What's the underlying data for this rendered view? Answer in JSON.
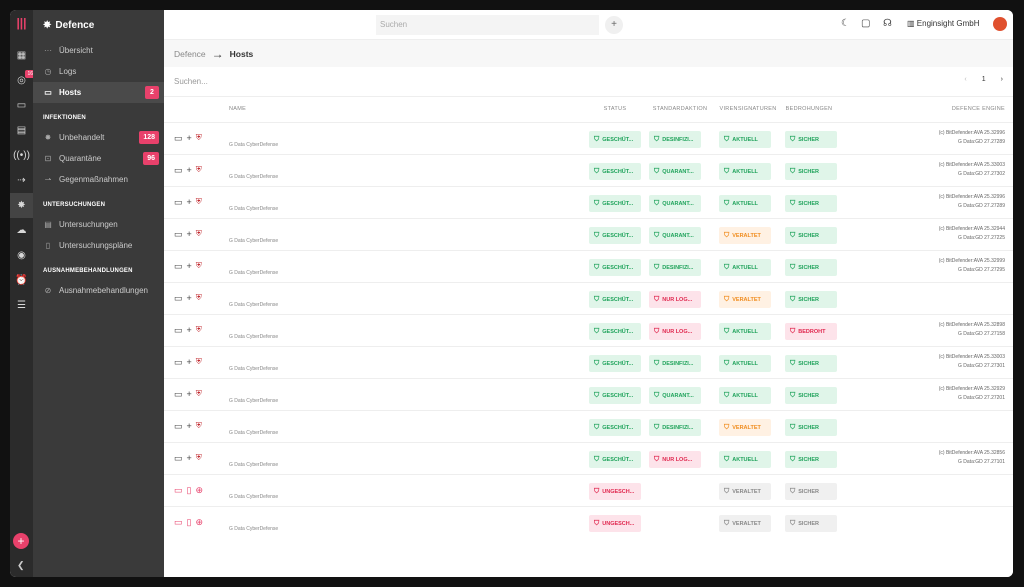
{
  "app": {
    "title": "Defence"
  },
  "rail": {
    "badge": "16"
  },
  "sidebar": {
    "items": [
      {
        "label": "Übersicht",
        "icon": "dots-icon"
      },
      {
        "label": "Logs",
        "icon": "clock-icon"
      },
      {
        "label": "Hosts",
        "icon": "laptop-icon",
        "count": "2"
      }
    ],
    "infektionen_title": "INFEKTIONEN",
    "infektionen": [
      {
        "label": "Unbehandelt",
        "icon": "virus-icon",
        "count": "128"
      },
      {
        "label": "Quarantäne",
        "icon": "quarantine-icon",
        "count": "96"
      },
      {
        "label": "Gegenmaßnahmen",
        "icon": "countermeasure-icon"
      }
    ],
    "untersuchungen_title": "UNTERSUCHUNGEN",
    "untersuchungen": [
      {
        "label": "Untersuchungen",
        "icon": "scan-icon"
      },
      {
        "label": "Untersuchungspläne",
        "icon": "schedule-icon"
      }
    ],
    "ausnahmen_title": "AUSNAHMEBEHANDLUNGEN",
    "ausnahmen": [
      {
        "label": "Ausnahmebehandlungen",
        "icon": "exception-icon"
      }
    ]
  },
  "topbar": {
    "search_placeholder": "Suchen",
    "org": "Enginsight GmbH"
  },
  "breadcrumb": {
    "parent": "Defence",
    "current": "Hosts"
  },
  "filter": {
    "placeholder": "Suchen...",
    "page": "1"
  },
  "table": {
    "headers": {
      "name": "NAME",
      "status": "STATUS",
      "action": "STANDARDAKTION",
      "sig": "VIRENSIGNATUREN",
      "threat": "BEDROHUNGEN",
      "engine": "DEFENCE ENGINE"
    },
    "rows": [
      {
        "name": "G Data CyberDefense",
        "status": "GESCHÜT...",
        "st": "ok",
        "action": "DESINFIZI...",
        "ac": "ok",
        "sig": "AKTUELL",
        "sg": "ok",
        "threat": "SICHER",
        "th": "ok",
        "e1": "(c) BitDefender:AVA 25.32996",
        "e2": "G Data:GD 27.27289",
        "bad": false
      },
      {
        "name": "G Data CyberDefense",
        "status": "GESCHÜT...",
        "st": "ok",
        "action": "QUARANT...",
        "ac": "ok",
        "sig": "AKTUELL",
        "sg": "ok",
        "threat": "SICHER",
        "th": "ok",
        "e1": "(c) BitDefender:AVA 25.33003",
        "e2": "G Data:GD 27.27302",
        "bad": false
      },
      {
        "name": "G Data CyberDefense",
        "status": "GESCHÜT...",
        "st": "ok",
        "action": "QUARANT...",
        "ac": "ok",
        "sig": "AKTUELL",
        "sg": "ok",
        "threat": "SICHER",
        "th": "ok",
        "e1": "(c) BitDefender:AVA 25.32996",
        "e2": "G Data:GD 27.27289",
        "bad": false
      },
      {
        "name": "G Data CyberDefense",
        "status": "GESCHÜT...",
        "st": "ok",
        "action": "QUARANT...",
        "ac": "ok",
        "sig": "VERALTET",
        "sg": "warn",
        "threat": "SICHER",
        "th": "ok",
        "e1": "(c) BitDefender:AVA 25.32944",
        "e2": "G Data:GD 27.27225",
        "bad": false
      },
      {
        "name": "G Data CyberDefense",
        "status": "GESCHÜT...",
        "st": "ok",
        "action": "DESINFIZI...",
        "ac": "ok",
        "sig": "AKTUELL",
        "sg": "ok",
        "threat": "SICHER",
        "th": "ok",
        "e1": "(c) BitDefender:AVA 25.32999",
        "e2": "G Data:GD 27.27295",
        "bad": false
      },
      {
        "name": "G Data CyberDefense",
        "status": "GESCHÜT...",
        "st": "ok",
        "action": "NUR LOG...",
        "ac": "err",
        "sig": "VERALTET",
        "sg": "warn",
        "threat": "SICHER",
        "th": "ok",
        "e1": "",
        "e2": "",
        "bad": false
      },
      {
        "name": "G Data CyberDefense",
        "status": "GESCHÜT...",
        "st": "ok",
        "action": "NUR LOG...",
        "ac": "err",
        "sig": "AKTUELL",
        "sg": "ok",
        "threat": "BEDROHT",
        "th": "err",
        "e1": "(c) BitDefender:AVA 25.32898",
        "e2": "G Data:GD 27.27158",
        "bad": false
      },
      {
        "name": "G Data CyberDefense",
        "status": "GESCHÜT...",
        "st": "ok",
        "action": "DESINFIZI...",
        "ac": "ok",
        "sig": "AKTUELL",
        "sg": "ok",
        "threat": "SICHER",
        "th": "ok",
        "e1": "(c) BitDefender:AVA 25.33003",
        "e2": "G Data:GD 27.27301",
        "bad": false
      },
      {
        "name": "G Data CyberDefense",
        "status": "GESCHÜT...",
        "st": "ok",
        "action": "QUARANT...",
        "ac": "ok",
        "sig": "AKTUELL",
        "sg": "ok",
        "threat": "SICHER",
        "th": "ok",
        "e1": "(c) BitDefender:AVA 25.32929",
        "e2": "G Data:GD 27.27201",
        "bad": false
      },
      {
        "name": "G Data CyberDefense",
        "status": "GESCHÜT...",
        "st": "ok",
        "action": "DESINFIZI...",
        "ac": "ok",
        "sig": "VERALTET",
        "sg": "warn",
        "threat": "SICHER",
        "th": "ok",
        "e1": "",
        "e2": "",
        "bad": false
      },
      {
        "name": "G Data CyberDefense",
        "status": "GESCHÜT...",
        "st": "ok",
        "action": "NUR LOG...",
        "ac": "err",
        "sig": "AKTUELL",
        "sg": "ok",
        "threat": "SICHER",
        "th": "ok",
        "e1": "(c) BitDefender:AVA 25.32856",
        "e2": "G Data:GD 27.27101",
        "bad": false
      },
      {
        "name": "G Data CyberDefense",
        "status": "UNGESCH...",
        "st": "err",
        "action": "",
        "ac": "",
        "sig": "VERALTET",
        "sg": "dim",
        "threat": "SICHER",
        "th": "dim",
        "e1": "",
        "e2": "",
        "bad": true
      },
      {
        "name": "G Data CyberDefense",
        "status": "UNGESCH...",
        "st": "err",
        "action": "",
        "ac": "",
        "sig": "VERALTET",
        "sg": "dim",
        "threat": "SICHER",
        "th": "dim",
        "e1": "",
        "e2": "",
        "bad": true
      }
    ]
  },
  "colors": {
    "accent": "#e8416b",
    "ok": "#1fa35b",
    "warn": "#f08c1e",
    "err": "#e0284f"
  }
}
